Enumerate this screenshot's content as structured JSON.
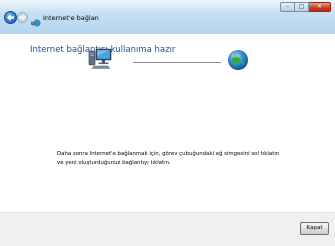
{
  "window": {
    "title": "Internet'e bağlan",
    "caption_buttons": {
      "minimize": "–",
      "maximize": "□",
      "close": "✕"
    }
  },
  "content": {
    "heading": "Internet bağlantısı kullanıma hazır",
    "info_text": "Daha sonra Internet'e bağlanmak için, görev çubuğundaki ağ simgesini sol tıklatın ve yeni oluşturduğunuz bağlantıyı tıklatın."
  },
  "footer": {
    "close_label": "Kapat"
  },
  "icons": {
    "back": "back-arrow-icon",
    "forward": "forward-arrow-icon",
    "app": "network-globe-icon",
    "computer": "computer-icon",
    "internet": "globe-icon"
  },
  "colors": {
    "heading": "#1e4f9c",
    "titlebar": "#c3dff2",
    "footer": "#f0f0f0"
  }
}
